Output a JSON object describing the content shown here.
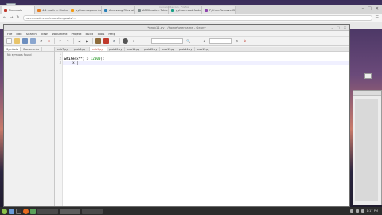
{
  "desktop": {
    "icon_label": "Computer"
  },
  "browser": {
    "tabs": [
      {
        "label": "Numerals",
        "color": "#c0392b"
      },
      {
        "label": "4.1 math — Mathematical fun",
        "color": "#e67e22"
      },
      {
        "label": "python-exponents - Geo",
        "color": "#f39c12"
      },
      {
        "label": "Accessing Files with Pyt",
        "color": "#2980b9"
      },
      {
        "label": "ASCII code – Table, con",
        "color": "#7f8c8d"
      },
      {
        "label": "python-read-folder – Go",
        "color": "#16a085"
      },
      {
        "label": "Python-Remove-Charact",
        "color": "#8e44ad"
      }
    ],
    "url": "runnercode.com/education/posts/...",
    "top_title": "runnercode.com · Firefox"
  },
  "geany": {
    "title": "*prob11.py - /home/username - Geany",
    "menu": [
      "File",
      "Edit",
      "Search",
      "View",
      "Document",
      "Project",
      "Build",
      "Tools",
      "Help"
    ],
    "sidebar_tabs": [
      "Symbols",
      "Documents"
    ],
    "sidebar_msg": "No symbols found",
    "doc_tabs": [
      "prob7.py",
      "prob8.py",
      "prob9.py",
      "prob10.py",
      "prob11.py",
      "prob12.py",
      "prob13.py",
      "prob14.py",
      "prob15.py"
    ],
    "active_doc": 2,
    "code_lines": [
      {
        "num": "1",
        "pre": "",
        "kw": "",
        "rest": "",
        "numlit": "",
        "post": ""
      },
      {
        "num": "2",
        "pre": "",
        "kw": "while",
        "rest": "(x**) > ",
        "numlit": "12000",
        "post": "):"
      },
      {
        "num": "3",
        "pre": "    x |",
        "kw": "",
        "rest": "",
        "numlit": "",
        "post": ""
      }
    ]
  },
  "taskbar": {
    "clock": "1:17 PM"
  }
}
